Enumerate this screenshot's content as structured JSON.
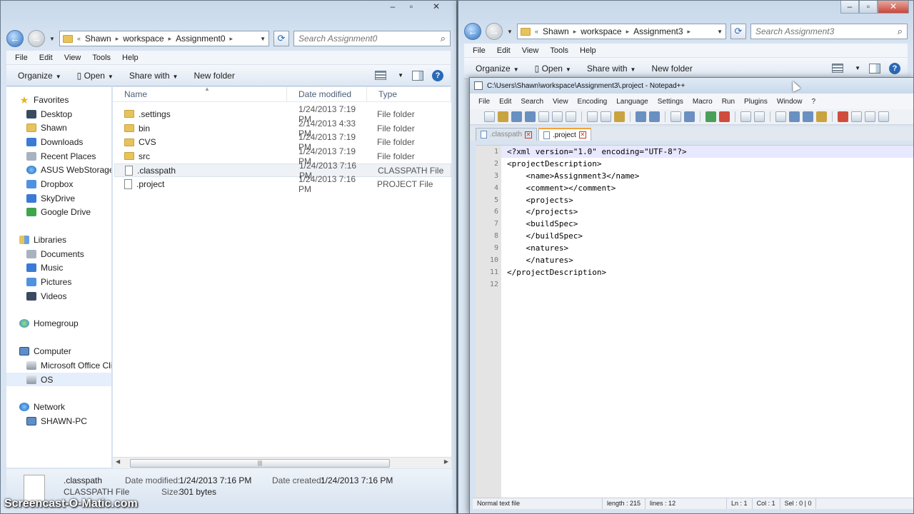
{
  "explorer_left": {
    "path": [
      "Shawn",
      "workspace",
      "Assignment0"
    ],
    "search_placeholder": "Search Assignment0",
    "menu": [
      "File",
      "Edit",
      "View",
      "Tools",
      "Help"
    ],
    "commands": {
      "organize": "Organize",
      "open": "Open",
      "share": "Share with",
      "new_folder": "New folder"
    },
    "nav": {
      "favorites": "Favorites",
      "fav_items": [
        "Desktop",
        "Shawn",
        "Downloads",
        "Recent Places",
        "ASUS WebStorage D",
        "Dropbox",
        "SkyDrive",
        "Google Drive"
      ],
      "libraries": "Libraries",
      "lib_items": [
        "Documents",
        "Music",
        "Pictures",
        "Videos"
      ],
      "homegroup": "Homegroup",
      "computer": "Computer",
      "comp_items": [
        "Microsoft Office Clic",
        "OS"
      ],
      "network": "Network",
      "net_items": [
        "SHAWN-PC"
      ]
    },
    "columns": {
      "name": "Name",
      "date": "Date modified",
      "type": "Type"
    },
    "files": [
      {
        "name": ".settings",
        "date": "1/24/2013 7:19 PM",
        "type": "File folder"
      },
      {
        "name": "bin",
        "date": "2/14/2013 4:33 PM",
        "type": "File folder"
      },
      {
        "name": "CVS",
        "date": "1/24/2013 7:19 PM",
        "type": "File folder"
      },
      {
        "name": "src",
        "date": "1/24/2013 7:19 PM",
        "type": "File folder"
      },
      {
        "name": ".classpath",
        "date": "1/24/2013 7:16 PM",
        "type": "CLASSPATH File"
      },
      {
        "name": ".project",
        "date": "1/24/2013 7:16 PM",
        "type": "PROJECT File"
      }
    ],
    "details": {
      "name": ".classpath",
      "type": "CLASSPATH File",
      "modified_label": "Date modified:",
      "modified_value": "1/24/2013 7:16 PM",
      "size_label": "Size:",
      "size_value": "301 bytes",
      "created_label": "Date created:",
      "created_value": "1/24/2013 7:16 PM"
    }
  },
  "explorer_right": {
    "path": [
      "Shawn",
      "workspace",
      "Assignment3"
    ],
    "search_placeholder": "Search Assignment3",
    "menu": [
      "File",
      "Edit",
      "View",
      "Tools",
      "Help"
    ],
    "commands": {
      "organize": "Organize",
      "open": "Open",
      "share": "Share with",
      "new_folder": "New folder"
    }
  },
  "notepad": {
    "title": "C:\\Users\\Shawn\\workspace\\Assignment3\\.project - Notepad++",
    "menu": [
      "File",
      "Edit",
      "Search",
      "View",
      "Encoding",
      "Language",
      "Settings",
      "Macro",
      "Run",
      "Plugins",
      "Window",
      "?"
    ],
    "tabs": [
      ".classpath",
      ".project"
    ],
    "lines": [
      "<?xml version=\"1.0\" encoding=\"UTF-8\"?>",
      "<projectDescription>",
      "    <name>Assignment3</name>",
      "    <comment></comment>",
      "    <projects>",
      "    </projects>",
      "    <buildSpec>",
      "    </buildSpec>",
      "    <natures>",
      "    </natures>",
      "</projectDescription>",
      ""
    ],
    "line_numbers": [
      "1",
      "2",
      "3",
      "4",
      "5",
      "6",
      "7",
      "8",
      "9",
      "10",
      "11",
      "12"
    ],
    "status": {
      "type": "Normal text file",
      "length": "length : 215",
      "lines": "lines : 12",
      "ln": "Ln : 1",
      "col": "Col : 1",
      "sel": "Sel : 0 | 0"
    }
  },
  "watermark": "Screencast-O-Matic.com"
}
